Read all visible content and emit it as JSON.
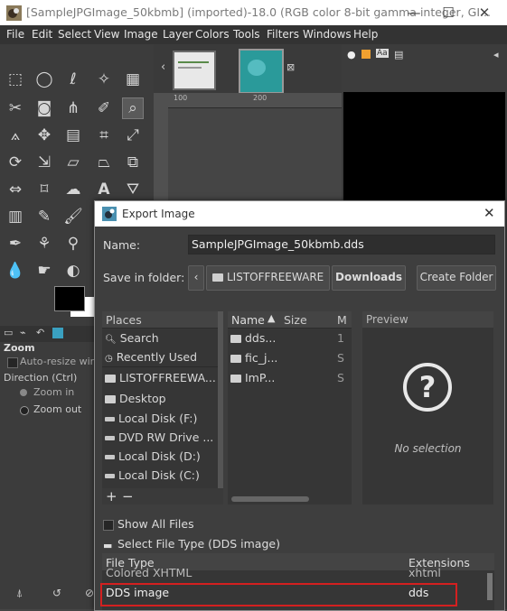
{
  "window": {
    "title": "[SampleJPGImage_50kbmb] (imported)-18.0 (RGB color 8-bit gamma integer, GI...",
    "minimize": "—",
    "maximize": "☐",
    "close": "✕"
  },
  "menu": [
    "File",
    "Edit",
    "Select",
    "View",
    "Image",
    "Layer",
    "Colors",
    "Tools",
    "Filters",
    "Windows",
    "Help"
  ],
  "rulers": {
    "h1": "100",
    "h2": "200"
  },
  "tool_options": {
    "section": "Zoom",
    "auto_resize": "Auto-resize win",
    "direction_label": "Direction  (Ctrl)",
    "zoom_in": "Zoom in",
    "zoom_out": "Zoom out"
  },
  "export_dialog": {
    "title": "Export Image",
    "name_label": "Name:",
    "name_value": "SampleJPGImage_50kbmb.dds",
    "save_in_label": "Save in folder:",
    "path": [
      "LISTOFFREEWARE",
      "Downloads"
    ],
    "create_folder": "Create Folder",
    "places_header": "Places",
    "places": [
      {
        "icon": "search-icon",
        "label": "Search"
      },
      {
        "icon": "clock-icon",
        "label": "Recently Used"
      },
      {
        "icon": "folder-icon",
        "label": "LISTOFFREEWA..."
      },
      {
        "icon": "folder-icon",
        "label": "Desktop"
      },
      {
        "icon": "disk-icon",
        "label": "Local Disk (F:)"
      },
      {
        "icon": "disk-icon",
        "label": "DVD RW Drive ..."
      },
      {
        "icon": "disk-icon",
        "label": "Local Disk (D:)"
      },
      {
        "icon": "disk-icon",
        "label": "Local Disk (C:)"
      }
    ],
    "add_place": "+",
    "remove_place": "−",
    "files_columns": {
      "name": "Name",
      "size": "Size",
      "modified": "M"
    },
    "files": [
      {
        "name": "dds...",
        "size": "",
        "modified": "1"
      },
      {
        "name": "fic_j...",
        "size": "",
        "modified": "S"
      },
      {
        "name": "ImP...",
        "size": "",
        "modified": "S"
      }
    ],
    "preview_header": "Preview",
    "preview_text": "No selection",
    "show_all_files": "Show All Files",
    "select_file_type": "Select File Type (DDS image)",
    "filetype_columns": {
      "type": "File Type",
      "ext": "Extensions"
    },
    "filetypes": [
      {
        "type": "Colored XHTML",
        "ext": "xhtml"
      },
      {
        "type": "DDS image",
        "ext": "dds"
      }
    ],
    "highlight_color": "#d42020"
  }
}
